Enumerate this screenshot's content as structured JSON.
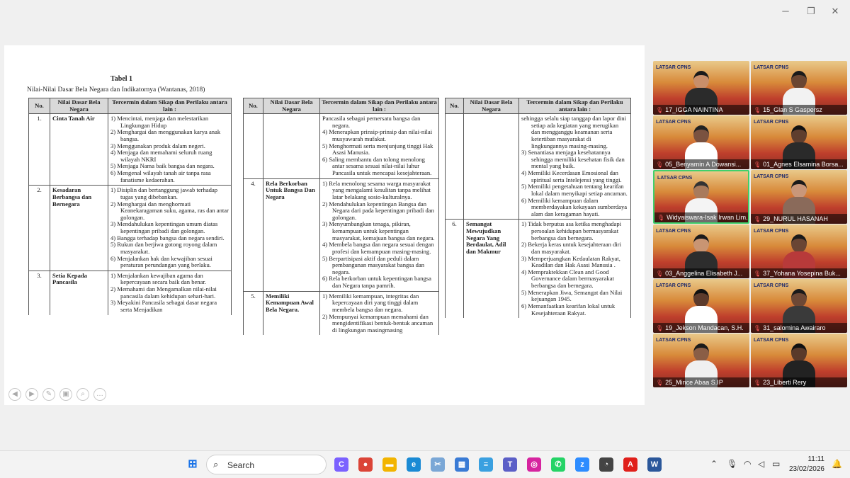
{
  "window": {
    "minimize_icon": "minimize-icon",
    "restore_icon": "restore-icon",
    "close_icon": "close-icon"
  },
  "slide": {
    "title": "Tabel 1",
    "subtitle": "Nilai-Nilai Dasar Bela Negara dan Indikatornya (Wantanas, 2018)",
    "headers": {
      "no": "No.",
      "nilai": "Nilai Dasar Bela Negara",
      "sikap": "Tercermin dalam Sikap dan Perilaku antara lain :"
    },
    "table1": [
      {
        "no": "1.",
        "value": "Cinta Tanah Air",
        "items": [
          "1) Mencintai, menjaga dan melestarikan Lingkungan Hidup",
          "2) Menghargai dan menggunakan karya anak bangsa.",
          "3) Menggunakan produk dalam negeri.",
          "4) Menjaga dan memahami seluruh ruang wilayah NKRI",
          "5) Menjaga Nama baik bangsa dan negara.",
          "6) Mengenal wilayah tanah air tanpa rasa fanatisme kedaerahan."
        ]
      },
      {
        "no": "2.",
        "value": "Kesadaran Berbangsa dan Bernegara",
        "items": [
          "1) Disiplin dan bertanggung jawab terhadap tugas yang dibebankan.",
          "2) Menghargai dan menghormati Keanekaragaman suku, agama, ras dan antar golongan.",
          "3) Mendahulukan kepentingan umum diatas kepentingan pribadi dan golongan.",
          "4) Bangga terhadap bangsa dan negara sendiri.",
          "5) Rukun dan berjiwa gotong royong dalam masyarakat.",
          "6) Menjalankan hak dan kewajiban sesuai peraturan perundangan yang berlaku."
        ]
      },
      {
        "no": "3.",
        "value": "Setia Kepada Pancasila",
        "items": [
          "1) Menjalankan kewajiban agama dan kepercayaan secara baik dan benar.",
          "2) Memahami dan Mengamalkan nilai-nilai pancasila dalam kehidupan sehari-hari.",
          "3) Meyakini Pancasila sebagai dasar negara serta Menjadikan"
        ]
      }
    ],
    "table2": [
      {
        "no": "",
        "value": "",
        "items": [
          "Pancasila sebagai pemersatu bangsa dan negara.",
          "4) Menerapkan prinsip-prinsip dan nilai-nilai musyawarah mufakat.",
          "5) Menghormati serta menjunjung tinggi Hak Asasi Manusia.",
          "6) Saling membantu dan tolong menolong antar sesama sesuai nilai-nilai luhur Pancasila untuk mencapai kesejahteraan."
        ]
      },
      {
        "no": "4.",
        "value": "Rela Berkorban Untuk Bangsa Dan Negara",
        "items": [
          "1) Rela menolong sesama warga masyarakat yang mengalami kesulitan tanpa melihat latar belakang sosio-kulturalnya.",
          "2) Mendahulukan kepentingan Bangsa dan Negara dari pada kepentingan pribadi dan golongan.",
          "3) Menyumbangkan tenaga, pikiran, kemampuan untuk kepentingan masyarakat, kemajuan bangsa dan negara.",
          "4) Membela bangsa dan negara sesuai dengan profesi dan kemampuan masing-masing.",
          "5) Berpartisipasi aktif dan peduli dalam pembangunan masyarakat bangsa dan negara.",
          "6) Rela berkorban untuk kepentingan bangsa dan Negara tanpa pamrih."
        ]
      },
      {
        "no": "5.",
        "value": "Memiliki Kemampuan Awal Bela Negara.",
        "items": [
          "1) Memiliki kemampuan, integritas dan kepercayaan diri yang tinggi dalam membela bangsa dan negara.",
          "2) Mempunyai kemampuan memahami dan mengidentifikasi bentuk-bentuk ancaman di lingkungan masingmasing"
        ]
      }
    ],
    "table3": [
      {
        "no": "",
        "value": "",
        "items": [
          "sehingga selalu siap tanggap dan lapor dini setiap ada kegiatan yang merugikan dan mengganggu keamanan serta ketertiban masyarakat di lingkungannya masing-masing.",
          "3) Senantiasa menjaga kesehatannya sehingga memiliki kesehatan fisik dan mental yang baik.",
          "4) Memiliki Kecerdasan Emosional dan spiritual serta Intelejensi yang tinggi.",
          "5) Memiliki pengetahuan tentang kearifan lokal dalam menyikapi setiap ancaman.",
          "6) Memiliki kemampuan dalam memberdayakan kekayaan sumberdaya alam dan keragaman hayati."
        ]
      },
      {
        "no": "6.",
        "value": "Semangat Mewujudkan Negara Yang Berdaulat, Adil dan Makmur",
        "items": [
          "1) Tidak berputus asa ketika menghadapi persoalan kehidupan bermasyarakat berbangsa dan bernegara.",
          "2) Bekerja keras untuk kesejahteraan diri dan masyarakat.",
          "3) Memperjuangkan Kedaulatan Rakyat, Keadilan dan Hak Asasi Manusia .",
          "4) Mempraktekkan Clean and Good Governance dalam bermasyarakat berbangsa dan bernegara.",
          "5) Menerapkan Jiwa, Semangat dan Nilai kejuangan 1945.",
          "6) Memanfaatkan kearifan lokal untuk Kesejahteraan Rakyat."
        ]
      }
    ]
  },
  "participants": [
    {
      "name": "17_IGGA NAINTINA",
      "skin": "#c98f6a",
      "cloth": "#2b2b2b",
      "hair": "#1a1a1a"
    },
    {
      "name": "15_Glan S Gaspersz",
      "skin": "#6b4632",
      "cloth": "#f2f2f2",
      "hair": "#1a1a1a"
    },
    {
      "name": "05_Benyamin A Dowansi...",
      "skin": "#7a5240",
      "cloth": "#ffffff",
      "hair": "#222222"
    },
    {
      "name": "01_Agnes Elsamina Borsa...",
      "skin": "#5f3e2e",
      "cloth": "#2a2a2a",
      "hair": "#111111"
    },
    {
      "name": "Widyaiswara-Isak Irwan Lim...",
      "skin": "#a97b5c",
      "cloth": "#f4f4f4",
      "hair": "#333333",
      "active": true,
      "banner": "LATSAR CPNS"
    },
    {
      "name": "29_NURUL HASANAH",
      "skin": "#c9977a",
      "cloth": "#8a6a5a",
      "hair": "#1a1a1a"
    },
    {
      "name": "03_Anggelina Elisabeth J...",
      "skin": "#c99573",
      "cloth": "#2d2d2d",
      "hair": "#1a1a1a"
    },
    {
      "name": "37_Yohana Yosepina Buk...",
      "skin": "#6a4534",
      "cloth": "#b83a3a",
      "hair": "#1a1a1a"
    },
    {
      "name": "19_Jekson Mandacan, S.H.",
      "skin": "#5c3b2c",
      "cloth": "#ffffff",
      "hair": "#111111"
    },
    {
      "name": "31_salomina Awairaro",
      "skin": "#6d4835",
      "cloth": "#3a3a3a",
      "hair": "#1a1a1a"
    },
    {
      "name": "25_Mince Abaa S.IP",
      "skin": "#8a5e46",
      "cloth": "#f0f0f0",
      "hair": "#1a1a1a"
    },
    {
      "name": "23_Liberti Rery",
      "skin": "#5a3a2a",
      "cloth": "#222222",
      "hair": "#111111"
    }
  ],
  "tile_banner": "LATSAR CPNS",
  "taskbar": {
    "search_placeholder": "Search",
    "time": "11:11",
    "date": "23/02/2026",
    "apps": [
      {
        "name": "copilot-icon",
        "color": "#7b61ff",
        "glyph": "C"
      },
      {
        "name": "chrome-icon",
        "color": "#db4437",
        "glyph": "●"
      },
      {
        "name": "file-explorer-icon",
        "color": "#f2b400",
        "glyph": "▬"
      },
      {
        "name": "edge-icon",
        "color": "#1a8ad4",
        "glyph": "e"
      },
      {
        "name": "snipping-tool-icon",
        "color": "#7aa7d6",
        "glyph": "✂"
      },
      {
        "name": "store-icon",
        "color": "#3a7bd5",
        "glyph": "▦"
      },
      {
        "name": "notepad-icon",
        "color": "#3aa0e0",
        "glyph": "≡"
      },
      {
        "name": "teams-icon",
        "color": "#5b5fc7",
        "glyph": "T"
      },
      {
        "name": "instagram-icon",
        "color": "#d6249f",
        "glyph": "◎"
      },
      {
        "name": "whatsapp-icon",
        "color": "#25d366",
        "glyph": "✆"
      },
      {
        "name": "zoom-icon",
        "color": "#2d8cff",
        "glyph": "z"
      },
      {
        "name": "camera-icon",
        "color": "#444444",
        "glyph": "◔"
      },
      {
        "name": "acrobat-icon",
        "color": "#e0201b",
        "glyph": "A"
      },
      {
        "name": "word-icon",
        "color": "#2b579a",
        "glyph": "W"
      }
    ]
  }
}
